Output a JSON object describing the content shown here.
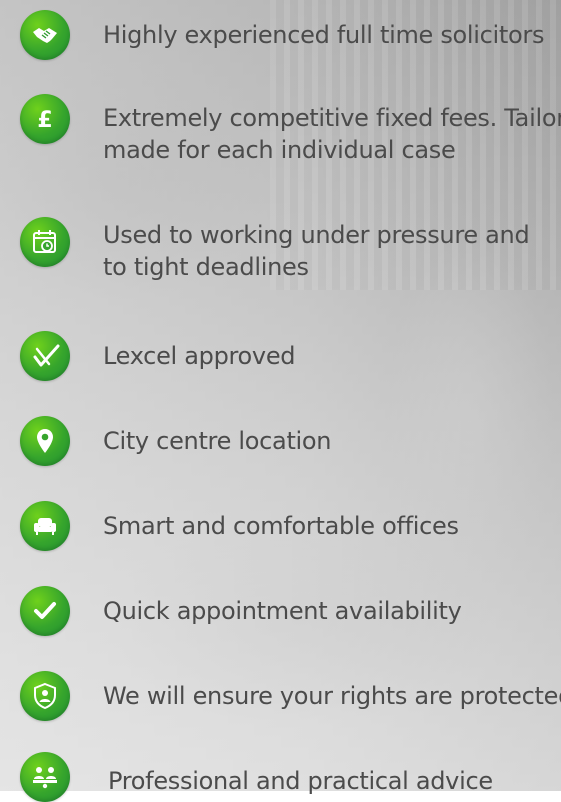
{
  "features": [
    {
      "icon": "handshake-icon",
      "text": "Highly experienced full time solicitors"
    },
    {
      "icon": "pound-icon",
      "line1": "Extremely competitive fixed fees. Tailor",
      "line2": "made for each individual case"
    },
    {
      "icon": "calendar-clock-icon",
      "line1": "Used to working under pressure and",
      "line2": "to tight deadlines"
    },
    {
      "icon": "lexcel-icon",
      "text": "Lexcel approved"
    },
    {
      "icon": "location-pin-icon",
      "text": "City centre location"
    },
    {
      "icon": "armchair-icon",
      "text": "Smart and comfortable offices"
    },
    {
      "icon": "checkmark-icon",
      "text": "Quick appointment availability"
    },
    {
      "icon": "shield-person-icon",
      "text": "We will ensure your rights are protected"
    },
    {
      "icon": "people-meeting-icon",
      "text": "Professional and practical advice"
    }
  ],
  "colors": {
    "icon_green": "#36a52c",
    "text_gray": "#4b4b4b"
  }
}
